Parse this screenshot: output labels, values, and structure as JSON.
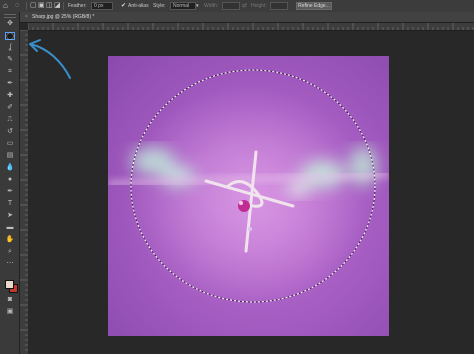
{
  "options_bar": {
    "feather_label": "Feather:",
    "feather_value": "0 px",
    "antialias_label": "Anti-alias",
    "style_label": "Style:",
    "style_value": "Normal",
    "width_label": "Width:",
    "height_label": "Height:",
    "refine_edge_label": "Refine Edge..."
  },
  "document_tab": {
    "close_glyph": "×",
    "title": "Sharp.jpg @ 25% (RGB/8) *"
  },
  "tools": [
    {
      "name": "move-tool-icon",
      "glyph": "✥"
    },
    {
      "name": "elliptical-marquee-tool-icon",
      "glyph": "◯",
      "active": true
    },
    {
      "name": "lasso-tool-icon",
      "glyph": "ʆ"
    },
    {
      "name": "quick-selection-tool-icon",
      "glyph": "✎"
    },
    {
      "name": "crop-tool-icon",
      "glyph": "⌗"
    },
    {
      "name": "eyedropper-tool-icon",
      "glyph": "✒"
    },
    {
      "name": "healing-brush-tool-icon",
      "glyph": "✚"
    },
    {
      "name": "brush-tool-icon",
      "glyph": "✐"
    },
    {
      "name": "clone-stamp-tool-icon",
      "glyph": "⎍"
    },
    {
      "name": "history-brush-tool-icon",
      "glyph": "↺"
    },
    {
      "name": "eraser-tool-icon",
      "glyph": "▭"
    },
    {
      "name": "gradient-tool-icon",
      "glyph": "▤"
    },
    {
      "name": "blur-tool-icon",
      "glyph": "💧"
    },
    {
      "name": "dodge-tool-icon",
      "glyph": "●"
    },
    {
      "name": "pen-tool-icon",
      "glyph": "✒"
    },
    {
      "name": "type-tool-icon",
      "glyph": "T"
    },
    {
      "name": "path-selection-tool-icon",
      "glyph": "➤"
    },
    {
      "name": "shape-tool-icon",
      "glyph": "▬"
    },
    {
      "name": "hand-tool-icon",
      "glyph": "✋"
    },
    {
      "name": "zoom-tool-icon",
      "glyph": "⌕"
    },
    {
      "name": "edit-toolbar-icon",
      "glyph": "⋯"
    }
  ],
  "colors": {
    "foreground": "#e8d8cc",
    "background": "#c0392b",
    "annotation_arrow": "#3a8fc9",
    "selection_marquee": "#ffffff"
  }
}
